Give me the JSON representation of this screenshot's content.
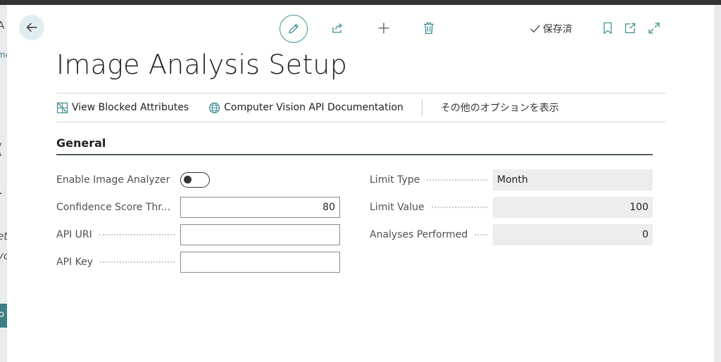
{
  "header": {
    "saved_label": "保存済"
  },
  "page": {
    "title": "Image Analysis Setup"
  },
  "actions": {
    "view_blocked": "View Blocked Attributes",
    "cv_docs": "Computer Vision API Documentation",
    "more_options": "その他のオプションを表示"
  },
  "section": {
    "title": "General"
  },
  "fields": {
    "enable_label": "Enable Image Analyzer",
    "enable_value": false,
    "confidence_label": "Confidence Score Thr...",
    "confidence_value": "80",
    "api_uri_label": "API URI",
    "api_uri_value": "",
    "api_key_label": "API Key",
    "api_key_value": "",
    "limit_type_label": "Limit Type",
    "limit_type_value": "Month",
    "limit_value_label": "Limit Value",
    "limit_value_value": "100",
    "analyses_label": "Analyses Performed",
    "analyses_value": "0"
  },
  "background": {
    "left_fragments": [
      "A",
      "me",
      "I",
      "(",
      "-",
      "et",
      "yo",
      "o"
    ]
  },
  "colors": {
    "accent": "#3f8f95",
    "back_bg": "#e1eef0",
    "readonly_bg": "#ededed",
    "section_rule": "#505c63"
  },
  "icons": [
    "back-arrow-icon",
    "edit-pencil-icon",
    "share-icon",
    "plus-icon",
    "trash-icon",
    "checkmark-icon",
    "bookmark-icon",
    "open-new-window-icon",
    "expand-icon",
    "blocked-attributes-icon",
    "globe-icon"
  ]
}
